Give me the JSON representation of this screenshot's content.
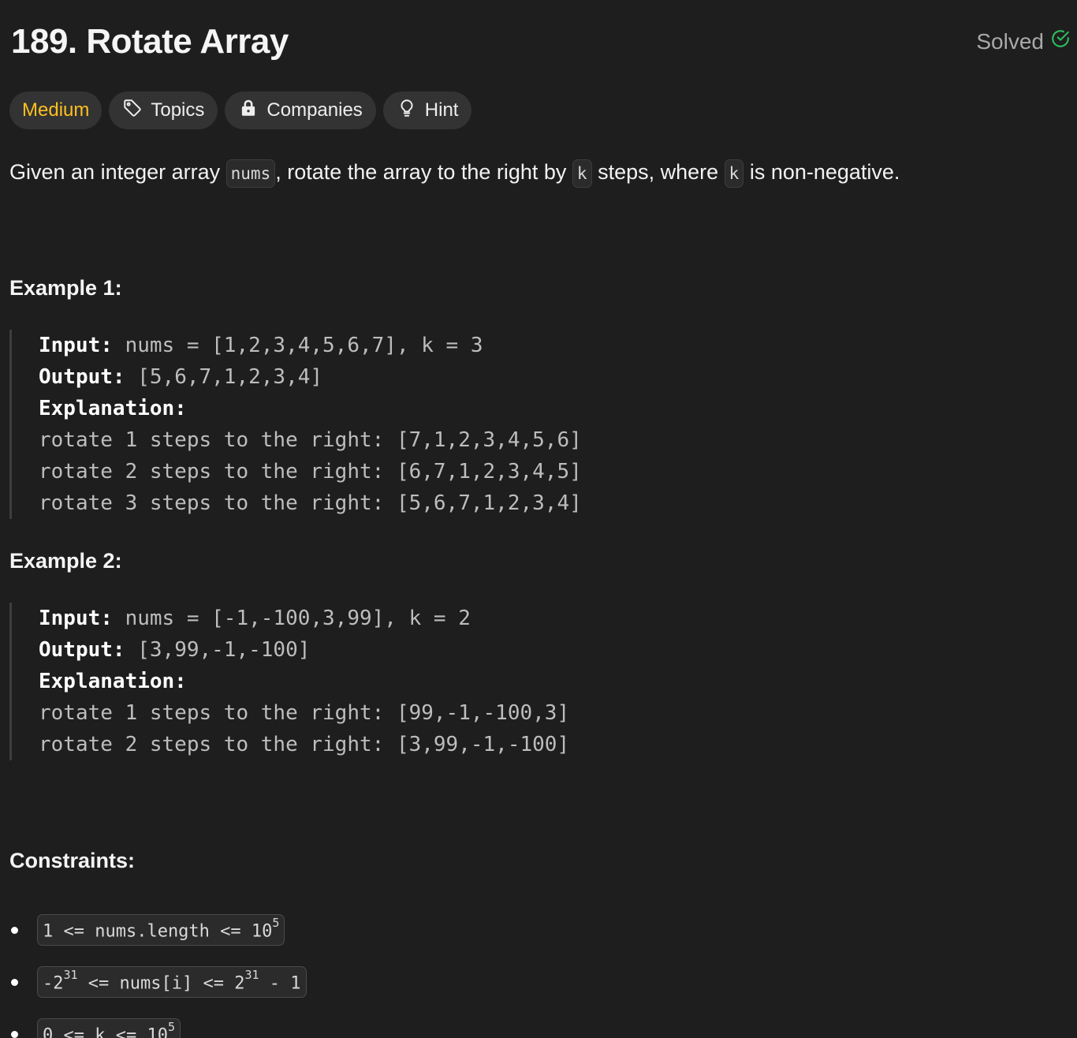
{
  "problem": {
    "title": "189. Rotate Array",
    "status": "Solved",
    "status_color": "#2cbb5d"
  },
  "tags": {
    "difficulty": "Medium",
    "difficulty_color": "#ffc01e",
    "topics": "Topics",
    "companies": "Companies",
    "hint": "Hint"
  },
  "description": {
    "p1": "Given an integer array ",
    "code1": "nums",
    "p2": ", rotate the array to the right by ",
    "code2": "k",
    "p3": " steps, where ",
    "code3": "k",
    "p4": " is non-negative."
  },
  "example1": {
    "heading": "Example 1:",
    "input_label": "Input:",
    "input_value": " nums = [1,2,3,4,5,6,7], k = 3",
    "output_label": "Output:",
    "output_value": " [5,6,7,1,2,3,4]",
    "explanation_label": "Explanation:",
    "steps": [
      "rotate 1 steps to the right: [7,1,2,3,4,5,6]",
      "rotate 2 steps to the right: [6,7,1,2,3,4,5]",
      "rotate 3 steps to the right: [5,6,7,1,2,3,4]"
    ]
  },
  "example2": {
    "heading": "Example 2:",
    "input_label": "Input:",
    "input_value": " nums = [-1,-100,3,99], k = 2",
    "output_label": "Output:",
    "output_value": " [3,99,-1,-100]",
    "explanation_label": "Explanation:",
    "steps": [
      "rotate 1 steps to the right: [99,-1,-100,3]",
      "rotate 2 steps to the right: [3,99,-1,-100]"
    ]
  },
  "constraints": {
    "heading": "Constraints:",
    "c1_a": "1 <= nums.length <= 10",
    "c1_sup": "5",
    "c2_a": "-2",
    "c2_sup1": "31",
    "c2_b": " <= nums[i] <= 2",
    "c2_sup2": "31",
    "c2_c": " - 1",
    "c3_a": "0 <= k <= 10",
    "c3_sup": "5"
  },
  "icons": {
    "status": "check-circle-icon",
    "topics": "tag-icon",
    "companies": "lock-icon",
    "hint": "lightbulb-icon"
  }
}
